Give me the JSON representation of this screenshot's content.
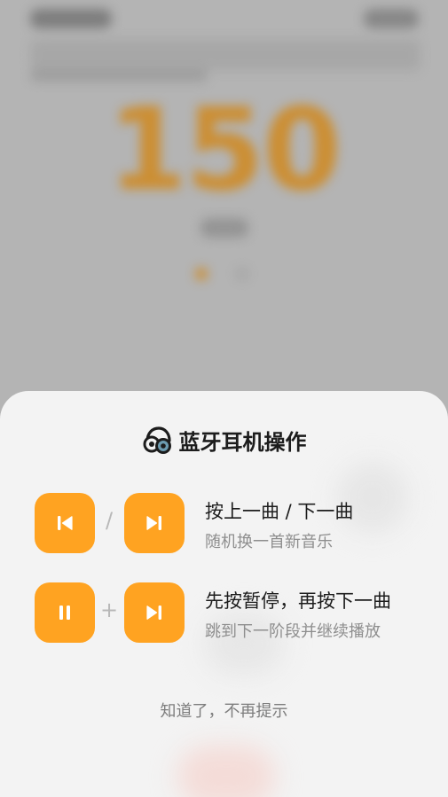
{
  "background": {
    "bpm_value": "150"
  },
  "sheet": {
    "title": "蓝牙耳机操作",
    "rows": [
      {
        "separator": "/",
        "title": "按上一曲 / 下一曲",
        "subtitle": "随机换一首新音乐",
        "left_icon": "previous-track-icon",
        "right_icon": "next-track-icon"
      },
      {
        "separator": "+",
        "title": "先按暂停，再按下一曲",
        "subtitle": "跳到下一阶段并继续播放",
        "left_icon": "pause-icon",
        "right_icon": "next-track-icon"
      }
    ],
    "dismiss_label": "知道了，不再提示"
  },
  "colors": {
    "accent": "#ffa321",
    "sheet_background": "#f3f3f3",
    "title_text": "#1c1c1c",
    "subtitle_text": "#8e8e8e"
  }
}
